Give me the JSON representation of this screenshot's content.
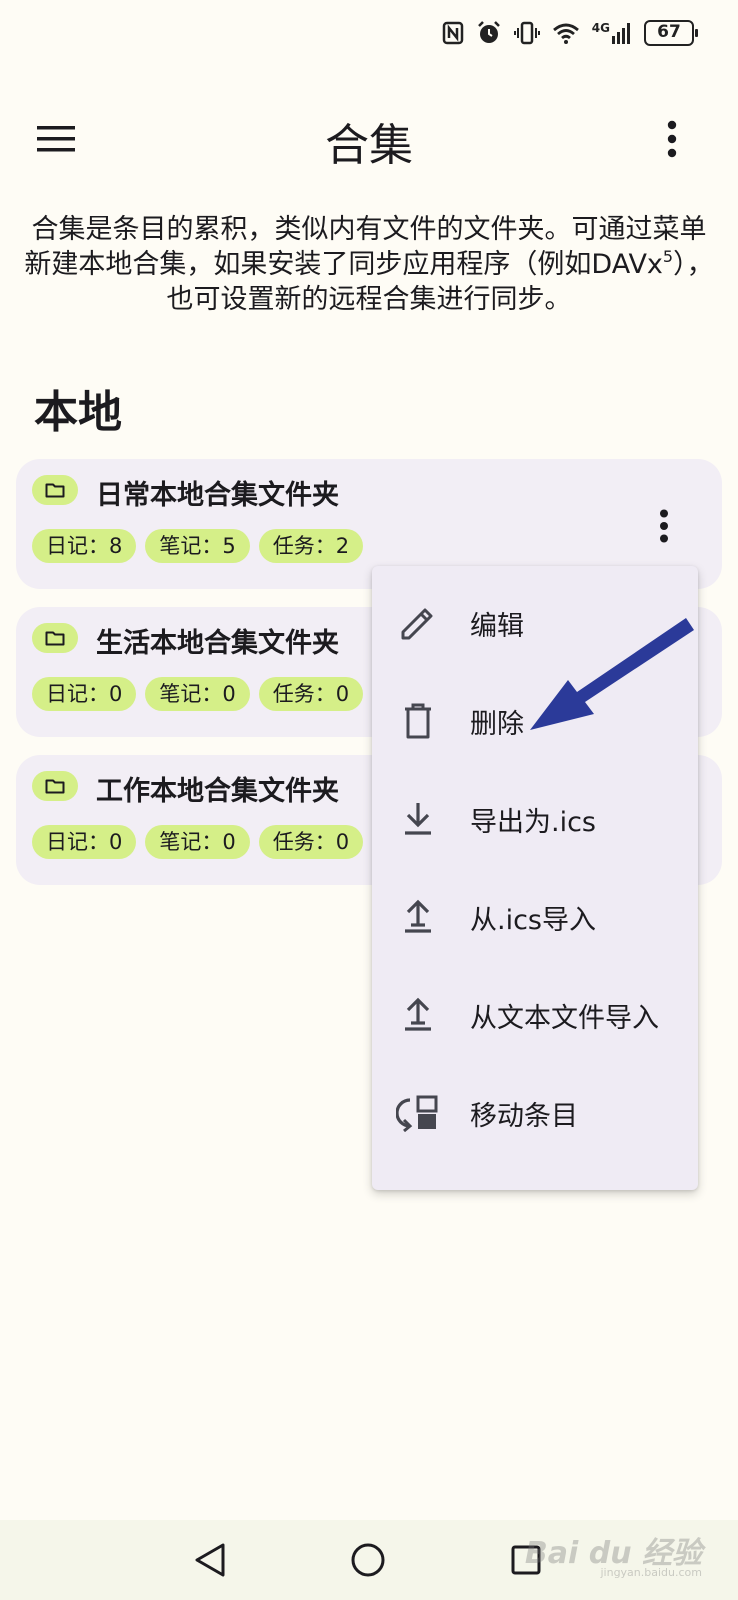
{
  "status": {
    "battery": "67",
    "network": "4G"
  },
  "appbar": {
    "title": "合集"
  },
  "description": {
    "text": "合集是条目的累积，类似内有文件的文件夹。可通过菜单新建本地合集，如果安装了同步应用程序（例如DAVx",
    "sup": "5",
    "tail": "），也可设置新的远程合集进行同步。"
  },
  "section": {
    "title": "本地"
  },
  "collections": [
    {
      "name": "日常本地合集文件夹",
      "journals": "日记：8",
      "notes": "笔记：5",
      "tasks": "任务：2"
    },
    {
      "name": "生活本地合集文件夹",
      "journals": "日记：0",
      "notes": "笔记：0",
      "tasks": "任务：0"
    },
    {
      "name": "工作本地合集文件夹",
      "journals": "日记：0",
      "notes": "笔记：0",
      "tasks": "任务：0"
    }
  ],
  "menu": {
    "items": [
      {
        "label": "编辑",
        "icon": "pencil-icon"
      },
      {
        "label": "删除",
        "icon": "trash-icon"
      },
      {
        "label": "导出为.ics",
        "icon": "download-icon"
      },
      {
        "label": "从.ics导入",
        "icon": "upload-icon"
      },
      {
        "label": "从文本文件导入",
        "icon": "upload-icon"
      },
      {
        "label": "移动条目",
        "icon": "move-icon"
      }
    ]
  },
  "watermark": {
    "text": "Bai du 经验",
    "sub": "jingyan.baidu.com"
  },
  "colors": {
    "background": "#fefcf5",
    "card": "#f2eef5",
    "chip": "#d5ef88",
    "menu": "#efebf4",
    "arrow": "#2b3a99"
  }
}
